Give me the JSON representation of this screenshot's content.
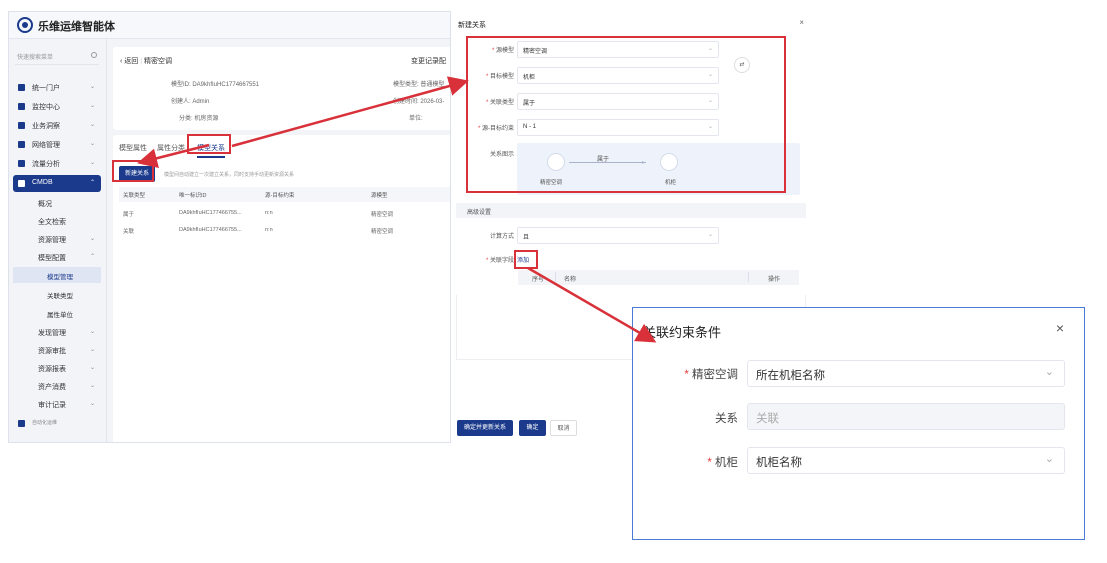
{
  "app": {
    "title": "乐维运维智能体",
    "sidebar": {
      "search_placeholder": "快速搜索菜单",
      "items": [
        {
          "label": "统一门户",
          "icon": "home-icon"
        },
        {
          "label": "监控中心",
          "icon": "monitor-icon"
        },
        {
          "label": "业务洞察",
          "icon": "insight-icon"
        },
        {
          "label": "网络管理",
          "icon": "network-icon"
        },
        {
          "label": "流量分析",
          "icon": "traffic-icon"
        },
        {
          "label": "CMDB",
          "icon": "cmdb-icon"
        }
      ],
      "cmdb_children": [
        "概况",
        "全文检索",
        "资源管理",
        "模型配置"
      ],
      "model_config_children": [
        "模型管理",
        "关联类型",
        "属性单位"
      ],
      "more_children": [
        "发现管理",
        "资源审批",
        "资源报表",
        "资产消费",
        "审计记录"
      ],
      "bottom_label": "自动化运维"
    },
    "main": {
      "back_label": "返回",
      "page_title": "精密空调",
      "change_record": "变更记录配",
      "info": {
        "model_id_label": "模型ID:",
        "model_id_value": "DA9khfIuHC1774667551",
        "creator_label": "创建人:",
        "creator_value": "Admin",
        "category_label": "分类:",
        "category_value": "机房资源",
        "model_type_label": "模型类型:",
        "model_type_value": "普通模型",
        "time_label": "创建时间:",
        "time_value": "2026-03-",
        "unit_label": "单位:"
      },
      "tabs": [
        "模型属性",
        "属性分类",
        "模型关系"
      ],
      "new_relation_btn": "新建关系",
      "hint_text": "模型间自动建立一次建立关系，同时支持手动更新资源关系",
      "table": {
        "headers": [
          "关联类型",
          "唯一标识ID",
          "源-目标约束",
          "源模型"
        ],
        "rows": [
          [
            "属于",
            "DA9khfIuHC177466755...",
            "n:n",
            "精密空调"
          ],
          [
            "关联",
            "DA9khfIuHC177466755...",
            "n:n",
            "精密空调"
          ]
        ]
      }
    }
  },
  "dialog": {
    "title": "新建关系",
    "close": "×",
    "fields": [
      {
        "label": "源模型",
        "value": "精密空调",
        "required": true
      },
      {
        "label": "目标模型",
        "value": "机柜",
        "required": true
      },
      {
        "label": "关联类型",
        "value": "属于",
        "required": true
      },
      {
        "label": "源-目标约束",
        "value": "N - 1",
        "required": true
      }
    ],
    "swap_icon": "⇄",
    "diagram_label": "关系图示",
    "diagram": {
      "source": "精密空调",
      "relation": "属于",
      "target": "机柜"
    },
    "advanced_title": "高级设置",
    "calc_label": "计算方式",
    "calc_value": "且",
    "link_field_label": "关联字段",
    "add_link": "添加",
    "sub_table_headers": [
      "序号",
      "名称",
      "操作"
    ],
    "buttons": {
      "confirm_update": "确定并更新关系",
      "confirm": "确定",
      "cancel": "取消"
    }
  },
  "constraint_dialog": {
    "title": "关联约束条件",
    "close": "×",
    "fields": [
      {
        "label": "精密空调",
        "value": "所在机柜名称",
        "required": true,
        "disabled": false
      },
      {
        "label": "关系",
        "value": "关联",
        "required": false,
        "disabled": true
      },
      {
        "label": "机柜",
        "value": "机柜名称",
        "required": true,
        "disabled": false
      }
    ]
  },
  "colors": {
    "primary": "#1b3a8c",
    "highlight": "#d8313a",
    "required": "#e23c3c"
  }
}
